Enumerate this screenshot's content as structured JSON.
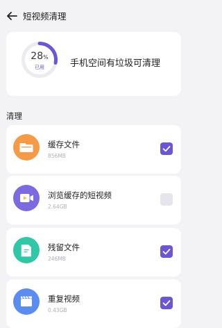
{
  "header": {
    "title": "短视频清理"
  },
  "summary": {
    "percent": 28,
    "percent_text": "28",
    "percent_unit": "%",
    "used_label": "已用",
    "message": "手机空间有垃圾可清理"
  },
  "section": {
    "title": "清理"
  },
  "items": [
    {
      "name": "缓存文件",
      "size": "856MB",
      "checked": true,
      "color": "#f59a46",
      "icon": "folder-icon"
    },
    {
      "name": "浏览缓存的短视频",
      "size": "2.64GB",
      "checked": false,
      "color": "#7b6ae0",
      "icon": "video-camera-icon"
    },
    {
      "name": "残留文件",
      "size": "246MB",
      "checked": true,
      "color": "#2fc7a6",
      "icon": "document-icon"
    },
    {
      "name": "重复视频",
      "size": "0.43GB",
      "checked": true,
      "color": "#5b8cf0",
      "icon": "clapperboard-icon"
    }
  ],
  "colors": {
    "accent": "#6a57d6",
    "ring_track": "#ececf0"
  }
}
